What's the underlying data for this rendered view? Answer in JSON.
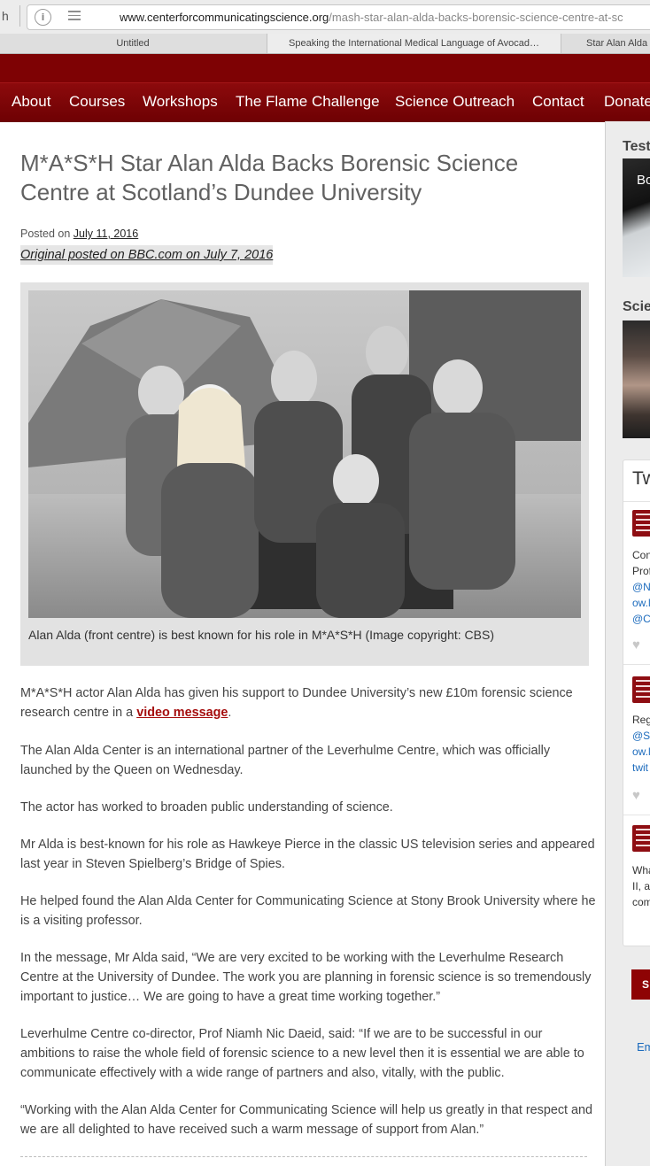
{
  "browser": {
    "left_fragment": "h",
    "url_host": "www.centerforcommunicatingscience.org",
    "url_path": "/mash-star-alan-alda-backs-borensic-science-centre-at-sc",
    "tabs": [
      {
        "label": "Untitled"
      },
      {
        "label": "Speaking the International Medical Language of Avocad…"
      },
      {
        "label": "Star Alan Alda"
      }
    ]
  },
  "nav": {
    "items": [
      "About",
      "Courses",
      "Workshops",
      "The Flame Challenge",
      "Science Outreach",
      "Contact",
      "Donate"
    ]
  },
  "article": {
    "title": "M*A*S*H Star Alan Alda Backs Borensic Science Centre at Scotland’s Dundee University",
    "posted_prefix": "Posted on",
    "posted_date": "July 11, 2016",
    "original_link": "Original posted on BBC.com on July 7, 2016",
    "caption": "Alan Alda (front centre) is best known for his role in M*A*S*H (Image copyright: CBS)",
    "p1_before": "M*A*S*H actor Alan Alda has given his support to Dundee University’s new £10m forensic science research centre in a ",
    "p1_link": "video message",
    "p1_after": ".",
    "p2": "The Alan Alda Center is an international partner of the Leverhulme Centre, which was officially launched by the Queen on Wednesday.",
    "p3": "The actor has worked to broaden public understanding of science.",
    "p4": "Mr Alda is best-known for his role as Hawkeye Pierce in the classic US television series and appeared last year in Steven Spielberg’s Bridge of Spies.",
    "p5": "He helped found the Alan Alda Center for Communicating Science at Stony Brook University where he is a visiting professor.",
    "p6": "In the message, Mr Alda said, “We are very excited to be working with the Leverhulme Research Centre at the University of Dundee. The work you are planning in forensic science is so tremendously important to justice… We are going to have a great time working together.”",
    "p7": "Leverhulme Centre co-director, Prof Niamh Nic Daeid, said: “If we are to be successful in our ambitions to raise the whole field of forensic science to a new level then it is essential we are able to communicate effectively with a wide range of partners and also, vitally, with the public.",
    "p8": "“Working with the Alan Alda Center for Communicating Science will help us greatly in that respect and we are all delighted to have received such a warm message of support from Alan.”"
  },
  "sidebar": {
    "widget1_title": "Test",
    "video_text": "Bo",
    "widget2_title": "Scie",
    "twitter_title": "Tw",
    "tweet1_lines": [
      "Con",
      "Prof",
      "@N",
      "ow.l",
      "@C"
    ],
    "tweet2_lines": [
      "Reg",
      "@S",
      "ow.l",
      "twit"
    ],
    "tweet3_lines": [
      "Wha",
      "II, a",
      "com"
    ],
    "embed_link": "Em",
    "button_label": "S"
  },
  "colors": {
    "brand_dark_red": "#7e0204",
    "link_red": "#a50d0d",
    "link_blue": "#1c6bbd"
  }
}
